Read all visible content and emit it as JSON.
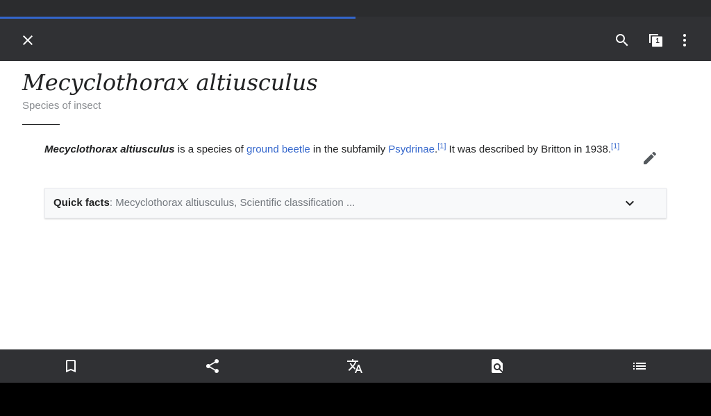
{
  "browser": {
    "load_progress": 0.5,
    "tab_count": "1"
  },
  "toolbar": {
    "close_icon": "close-icon",
    "search_icon": "search-icon",
    "tabs_icon": "tabs-icon",
    "overflow_icon": "more-vert-icon"
  },
  "article": {
    "title": "Mecyclothorax altiusculus",
    "description": "Species of insect",
    "lead": {
      "subject": "Mecyclothorax altiusculus",
      "text_1": " is a species of ",
      "link_1": "ground beetle",
      "text_2": " in the subfamily ",
      "link_2": "Psydrinae",
      "text_3": ".",
      "ref_1": "[1]",
      "text_4": " It was described by Britton in 1938.",
      "ref_2": "[1]"
    },
    "edit_icon": "pencil-icon",
    "quick_facts": {
      "label": "Quick facts",
      "separator": ": ",
      "summary": "Mecyclothorax altiusculus, Scientific classification ...",
      "chevron_icon": "chevron-down-icon"
    }
  },
  "bottom_bar": {
    "items": [
      {
        "icon": "bookmark-icon"
      },
      {
        "icon": "share-icon"
      },
      {
        "icon": "translate-icon"
      },
      {
        "icon": "find-in-page-icon"
      },
      {
        "icon": "contents-list-icon"
      }
    ]
  },
  "colors": {
    "toolbar_bg": "#303134",
    "progress": "#3366cc",
    "link": "#3366cc",
    "text": "#202122"
  }
}
